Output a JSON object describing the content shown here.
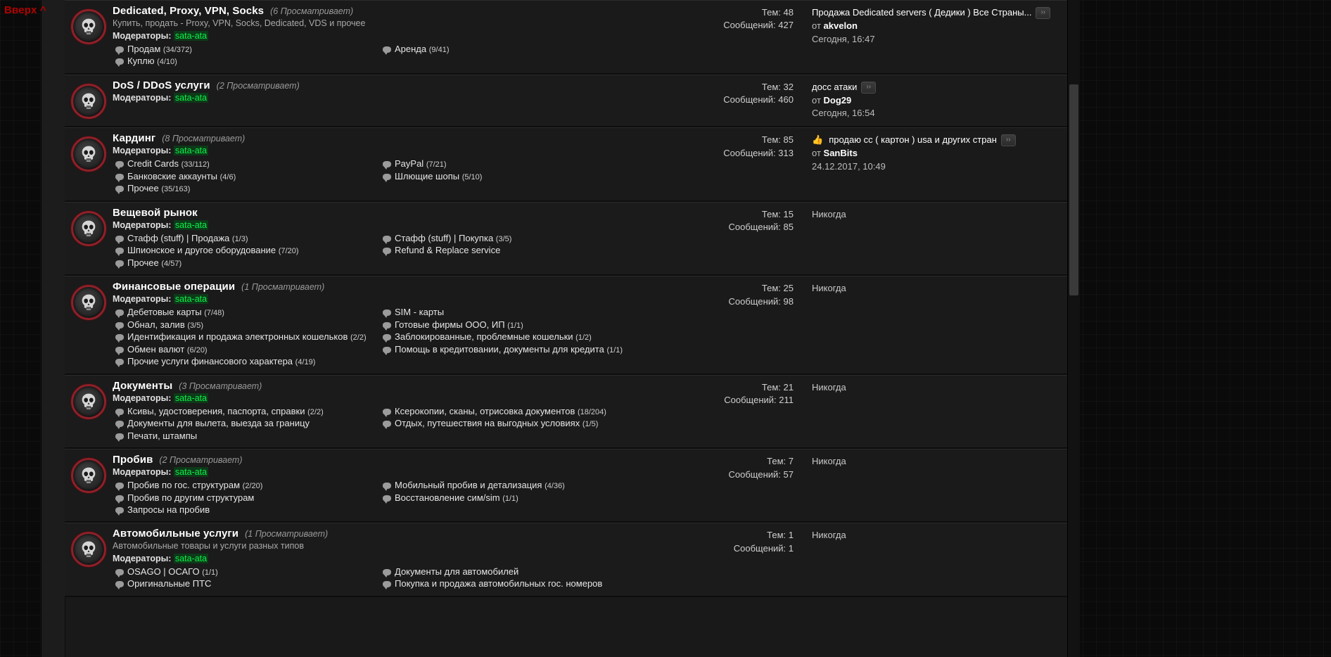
{
  "back_to_top": "Вверх ^",
  "labels": {
    "threads": "Тем:",
    "messages": "Сообщений:",
    "moderators": "Модераторы:",
    "by": "от",
    "never": "Никогда",
    "go_button": "››"
  },
  "colors": {
    "accent_red": "#b40000",
    "mod_green": "#0cf04a",
    "panel": "#1a1a1a",
    "page": "#191919"
  },
  "forums": [
    {
      "title": "Dedicated, Proxy, VPN, Socks",
      "viewing": "(6 Просматривает)",
      "description": "Купить, продать - Proxy, VPN, Socks, Dedicated, VDS и прочее",
      "moderator": "sata-ata",
      "subforums": [
        {
          "name": "Продам",
          "count": "(34/372)"
        },
        {
          "name": "Аренда",
          "count": "(9/41)"
        },
        {
          "name": "Куплю",
          "count": "(4/10)"
        },
        {
          "name": "",
          "count": ""
        }
      ],
      "threads": "48",
      "messages": "427",
      "last_post": {
        "title": "Продажа Dedicated servers ( Дедики ) Все Страны...",
        "has_go": true,
        "emoji": "",
        "author": "akvelon",
        "date": "Сегодня, 16:47",
        "never": false
      }
    },
    {
      "title": "DoS / DDoS услуги",
      "viewing": "(2 Просматривает)",
      "description": "",
      "moderator": "sata-ata",
      "subforums": [],
      "threads": "32",
      "messages": "460",
      "last_post": {
        "title": "досс атаки",
        "has_go": true,
        "emoji": "",
        "author": "Dog29",
        "date": "Сегодня, 16:54",
        "never": false
      }
    },
    {
      "title": "Кардинг",
      "viewing": "(8 Просматривает)",
      "description": "",
      "moderator": "sata-ata",
      "subforums": [
        {
          "name": "Credit Cards",
          "count": "(33/112)"
        },
        {
          "name": "PayPal",
          "count": "(7/21)"
        },
        {
          "name": "Банковские аккаунты",
          "count": "(4/6)"
        },
        {
          "name": "Шлющие шопы",
          "count": "(5/10)"
        },
        {
          "name": "Прочее",
          "count": "(35/163)"
        },
        {
          "name": "",
          "count": ""
        }
      ],
      "threads": "85",
      "messages": "313",
      "last_post": {
        "title": "продаю сс ( картон ) usa и других стран",
        "has_go": true,
        "emoji": "👍",
        "author": "SanBits",
        "date": "24.12.2017, 10:49",
        "never": false
      }
    },
    {
      "title": "Вещевой рынок",
      "viewing": "",
      "description": "",
      "moderator": "sata-ata",
      "subforums": [
        {
          "name": "Стафф (stuff) | Продажа",
          "count": "(1/3)"
        },
        {
          "name": "Стафф (stuff) | Покупка",
          "count": "(3/5)"
        },
        {
          "name": "Шпионское и другое оборудование",
          "count": "(7/20)"
        },
        {
          "name": "Refund & Replace service",
          "count": ""
        },
        {
          "name": "Прочее",
          "count": "(4/57)"
        },
        {
          "name": "",
          "count": ""
        }
      ],
      "threads": "15",
      "messages": "85",
      "last_post": {
        "title": "",
        "has_go": false,
        "emoji": "",
        "author": "",
        "date": "",
        "never": true
      }
    },
    {
      "title": "Финансовые операции",
      "viewing": "(1 Просматривает)",
      "description": "",
      "moderator": "sata-ata",
      "subforums": [
        {
          "name": "Дебетовые карты",
          "count": "(7/48)"
        },
        {
          "name": "SIM - карты",
          "count": ""
        },
        {
          "name": "Обнал, залив",
          "count": "(3/5)"
        },
        {
          "name": "Готовые фирмы ООО, ИП",
          "count": "(1/1)"
        },
        {
          "name": "Идентификация и продажа электронных кошельков",
          "count": "(2/2)"
        },
        {
          "name": "Заблокированные, проблемные кошельки",
          "count": "(1/2)"
        },
        {
          "name": "Обмен валют",
          "count": "(6/20)"
        },
        {
          "name": "Помощь в кредитовании, документы для кредита",
          "count": "(1/1)"
        },
        {
          "name": "Прочие услуги финансового характера",
          "count": "(4/19)"
        },
        {
          "name": "",
          "count": ""
        }
      ],
      "threads": "25",
      "messages": "98",
      "last_post": {
        "title": "",
        "has_go": false,
        "emoji": "",
        "author": "",
        "date": "",
        "never": true
      }
    },
    {
      "title": "Документы",
      "viewing": "(3 Просматривает)",
      "description": "",
      "moderator": "sata-ata",
      "subforums": [
        {
          "name": "Ксивы, удостоверения, паспорта, справки",
          "count": "(2/2)"
        },
        {
          "name": "Ксерокопии, сканы, отрисовка документов",
          "count": "(18/204)"
        },
        {
          "name": "Документы для вылета, выезда за границу",
          "count": ""
        },
        {
          "name": "Отдых, путешествия на выгодных условиях",
          "count": "(1/5)"
        },
        {
          "name": "Печати, штампы",
          "count": ""
        },
        {
          "name": "",
          "count": ""
        }
      ],
      "threads": "21",
      "messages": "211",
      "last_post": {
        "title": "",
        "has_go": false,
        "emoji": "",
        "author": "",
        "date": "",
        "never": true
      }
    },
    {
      "title": "Пробив",
      "viewing": "(2 Просматривает)",
      "description": "",
      "moderator": "sata-ata",
      "subforums": [
        {
          "name": "Пробив по гос. структурам",
          "count": "(2/20)"
        },
        {
          "name": "Мобильный пробив и детализация",
          "count": "(4/36)"
        },
        {
          "name": "Пробив по другим структурам",
          "count": ""
        },
        {
          "name": "Восстановление сим/sim",
          "count": "(1/1)"
        },
        {
          "name": "Запросы на пробив",
          "count": ""
        },
        {
          "name": "",
          "count": ""
        }
      ],
      "threads": "7",
      "messages": "57",
      "last_post": {
        "title": "",
        "has_go": false,
        "emoji": "",
        "author": "",
        "date": "",
        "never": true
      }
    },
    {
      "title": "Автомобильные услуги",
      "viewing": "(1 Просматривает)",
      "description": "Автомобильные товары и услуги разных типов",
      "moderator": "sata-ata",
      "subforums": [
        {
          "name": "OSAGO | ОСАГО",
          "count": "(1/1)"
        },
        {
          "name": "Документы для автомобилей",
          "count": ""
        },
        {
          "name": "Оригинальные ПТС",
          "count": ""
        },
        {
          "name": "Покупка и продажа автомобильных гос. номеров",
          "count": ""
        }
      ],
      "threads": "1",
      "messages": "1",
      "last_post": {
        "title": "",
        "has_go": false,
        "emoji": "",
        "author": "",
        "date": "",
        "never": true
      }
    }
  ]
}
